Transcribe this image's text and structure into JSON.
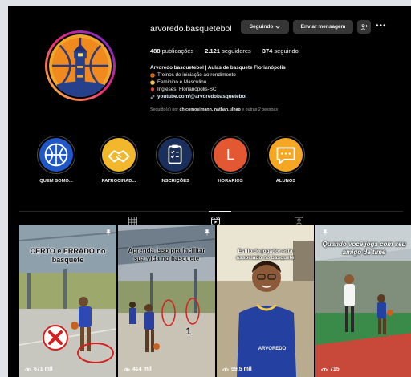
{
  "profile": {
    "username": "arvoredo.basquetebol",
    "follow_label": "Seguindo",
    "message_label": "Enviar mensagem",
    "more_label": "•••",
    "stats": {
      "posts_count": "488",
      "posts_label": "publicações",
      "followers_count": "2.121",
      "followers_label": "seguidores",
      "following_count": "374",
      "following_label": "seguindo"
    },
    "bio": {
      "name": "Arvoredo basquetebol | Aulas de basquete Florianópolis",
      "line1": "Treinos de iniciação ao rendimento",
      "line2": "Feminino e Masculino",
      "line3": "Ingleses, Florianópolis-SC",
      "link": "youtube.com/@arvoredobasquetebol"
    },
    "followed_by_prefix": "Seguido(a) por",
    "followed_by_names": "chicomosimann, nathan.ulhap",
    "followed_by_suffix": "e outras 2 pessoas"
  },
  "highlights": [
    {
      "label": "QUEM SOMO..."
    },
    {
      "label": "PATROCINAD..."
    },
    {
      "label": "INSCRIÇÕES"
    },
    {
      "label": "HORÁRIOS",
      "glyph": "L"
    },
    {
      "label": "ALUNOS"
    }
  ],
  "posts": [
    {
      "caption": "CERTO e ERRADO no basquete",
      "views": "671 mil"
    },
    {
      "caption": "Aprenda isso pra facilitar sua vida no basquete",
      "views": "414 mil",
      "overlay_number": "1"
    },
    {
      "caption": "Estilo do jogador está associado no basquete",
      "views": "59,5 mil",
      "shirt_text": "ARVOREDO"
    },
    {
      "caption": "Quando você joga com seu amigo de time",
      "views": "715"
    }
  ],
  "colors": {
    "background": "#000000",
    "button": "#363636",
    "muted_text": "#a8a8a8"
  }
}
